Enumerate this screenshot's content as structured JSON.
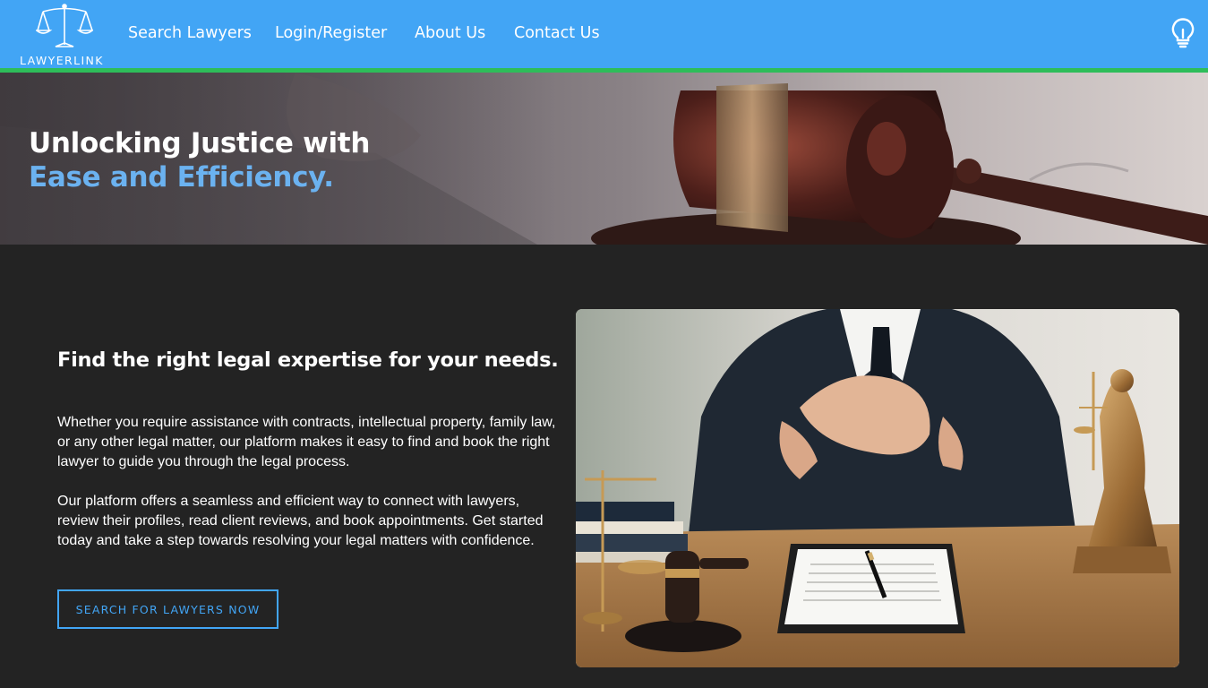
{
  "header": {
    "logo_text": "LAWYERLINK",
    "nav": [
      {
        "label": "Search Lawyers"
      },
      {
        "label": "Login/Register"
      },
      {
        "label": "About Us"
      },
      {
        "label": "Contact Us"
      }
    ],
    "theme_icon": "lightbulb-icon"
  },
  "hero": {
    "line1": "Unlocking Justice with",
    "line2": "Ease and Efficiency."
  },
  "main": {
    "heading": "Find the right legal expertise for your needs.",
    "paragraph1": "Whether you require assistance with contracts, intellectual property, family law, or any other legal matter, our platform makes it easy to find and book the right lawyer to guide you through the legal process.",
    "paragraph2": "Our platform offers a seamless and efficient way to connect with lawyers, review their profiles, read client reviews, and book appointments. Get started today and take a step towards resolving your legal matters with confidence.",
    "cta_label": "SEARCH FOR LAWYERS NOW"
  },
  "colors": {
    "nav_bg": "#42a5f5",
    "accent_line": "#2ebd5a",
    "page_bg": "#232323",
    "hero_highlight": "#6bb2f0"
  }
}
